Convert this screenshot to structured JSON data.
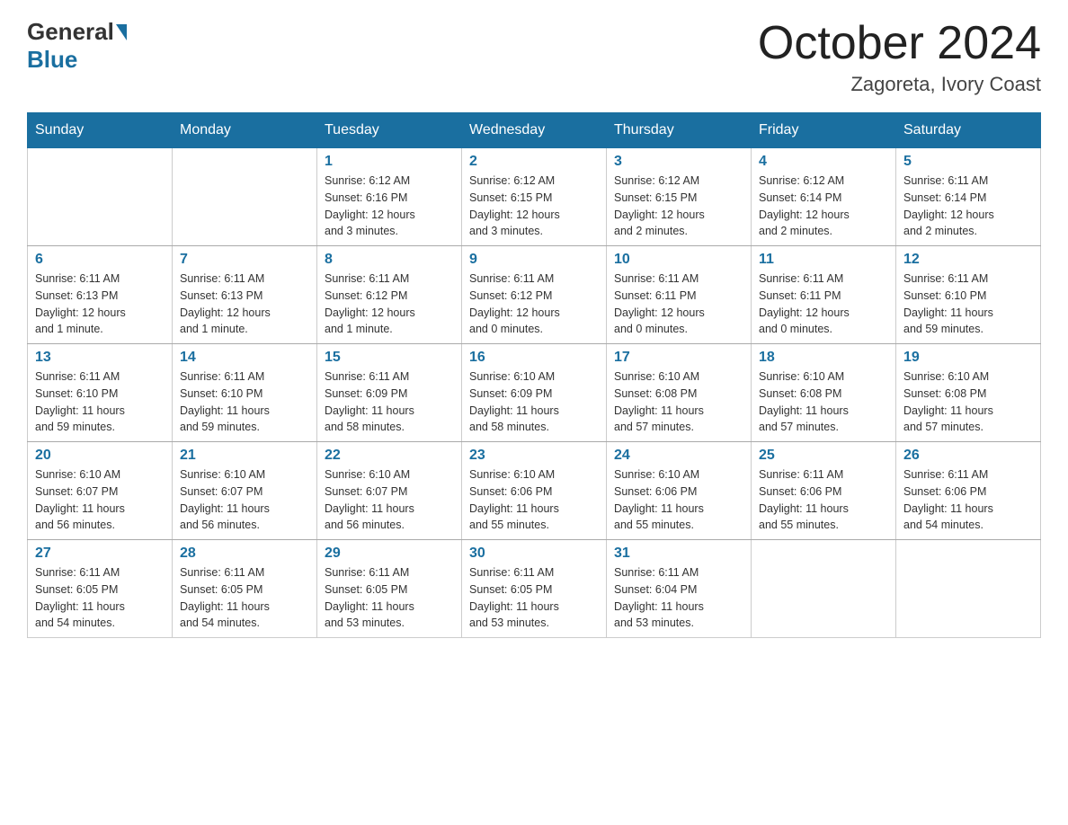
{
  "header": {
    "logo_general": "General",
    "logo_blue": "Blue",
    "month_title": "October 2024",
    "location": "Zagoreta, Ivory Coast"
  },
  "weekdays": [
    "Sunday",
    "Monday",
    "Tuesday",
    "Wednesday",
    "Thursday",
    "Friday",
    "Saturday"
  ],
  "weeks": [
    [
      {
        "day": "",
        "info": ""
      },
      {
        "day": "",
        "info": ""
      },
      {
        "day": "1",
        "info": "Sunrise: 6:12 AM\nSunset: 6:16 PM\nDaylight: 12 hours\nand 3 minutes."
      },
      {
        "day": "2",
        "info": "Sunrise: 6:12 AM\nSunset: 6:15 PM\nDaylight: 12 hours\nand 3 minutes."
      },
      {
        "day": "3",
        "info": "Sunrise: 6:12 AM\nSunset: 6:15 PM\nDaylight: 12 hours\nand 2 minutes."
      },
      {
        "day": "4",
        "info": "Sunrise: 6:12 AM\nSunset: 6:14 PM\nDaylight: 12 hours\nand 2 minutes."
      },
      {
        "day": "5",
        "info": "Sunrise: 6:11 AM\nSunset: 6:14 PM\nDaylight: 12 hours\nand 2 minutes."
      }
    ],
    [
      {
        "day": "6",
        "info": "Sunrise: 6:11 AM\nSunset: 6:13 PM\nDaylight: 12 hours\nand 1 minute."
      },
      {
        "day": "7",
        "info": "Sunrise: 6:11 AM\nSunset: 6:13 PM\nDaylight: 12 hours\nand 1 minute."
      },
      {
        "day": "8",
        "info": "Sunrise: 6:11 AM\nSunset: 6:12 PM\nDaylight: 12 hours\nand 1 minute."
      },
      {
        "day": "9",
        "info": "Sunrise: 6:11 AM\nSunset: 6:12 PM\nDaylight: 12 hours\nand 0 minutes."
      },
      {
        "day": "10",
        "info": "Sunrise: 6:11 AM\nSunset: 6:11 PM\nDaylight: 12 hours\nand 0 minutes."
      },
      {
        "day": "11",
        "info": "Sunrise: 6:11 AM\nSunset: 6:11 PM\nDaylight: 12 hours\nand 0 minutes."
      },
      {
        "day": "12",
        "info": "Sunrise: 6:11 AM\nSunset: 6:10 PM\nDaylight: 11 hours\nand 59 minutes."
      }
    ],
    [
      {
        "day": "13",
        "info": "Sunrise: 6:11 AM\nSunset: 6:10 PM\nDaylight: 11 hours\nand 59 minutes."
      },
      {
        "day": "14",
        "info": "Sunrise: 6:11 AM\nSunset: 6:10 PM\nDaylight: 11 hours\nand 59 minutes."
      },
      {
        "day": "15",
        "info": "Sunrise: 6:11 AM\nSunset: 6:09 PM\nDaylight: 11 hours\nand 58 minutes."
      },
      {
        "day": "16",
        "info": "Sunrise: 6:10 AM\nSunset: 6:09 PM\nDaylight: 11 hours\nand 58 minutes."
      },
      {
        "day": "17",
        "info": "Sunrise: 6:10 AM\nSunset: 6:08 PM\nDaylight: 11 hours\nand 57 minutes."
      },
      {
        "day": "18",
        "info": "Sunrise: 6:10 AM\nSunset: 6:08 PM\nDaylight: 11 hours\nand 57 minutes."
      },
      {
        "day": "19",
        "info": "Sunrise: 6:10 AM\nSunset: 6:08 PM\nDaylight: 11 hours\nand 57 minutes."
      }
    ],
    [
      {
        "day": "20",
        "info": "Sunrise: 6:10 AM\nSunset: 6:07 PM\nDaylight: 11 hours\nand 56 minutes."
      },
      {
        "day": "21",
        "info": "Sunrise: 6:10 AM\nSunset: 6:07 PM\nDaylight: 11 hours\nand 56 minutes."
      },
      {
        "day": "22",
        "info": "Sunrise: 6:10 AM\nSunset: 6:07 PM\nDaylight: 11 hours\nand 56 minutes."
      },
      {
        "day": "23",
        "info": "Sunrise: 6:10 AM\nSunset: 6:06 PM\nDaylight: 11 hours\nand 55 minutes."
      },
      {
        "day": "24",
        "info": "Sunrise: 6:10 AM\nSunset: 6:06 PM\nDaylight: 11 hours\nand 55 minutes."
      },
      {
        "day": "25",
        "info": "Sunrise: 6:11 AM\nSunset: 6:06 PM\nDaylight: 11 hours\nand 55 minutes."
      },
      {
        "day": "26",
        "info": "Sunrise: 6:11 AM\nSunset: 6:06 PM\nDaylight: 11 hours\nand 54 minutes."
      }
    ],
    [
      {
        "day": "27",
        "info": "Sunrise: 6:11 AM\nSunset: 6:05 PM\nDaylight: 11 hours\nand 54 minutes."
      },
      {
        "day": "28",
        "info": "Sunrise: 6:11 AM\nSunset: 6:05 PM\nDaylight: 11 hours\nand 54 minutes."
      },
      {
        "day": "29",
        "info": "Sunrise: 6:11 AM\nSunset: 6:05 PM\nDaylight: 11 hours\nand 53 minutes."
      },
      {
        "day": "30",
        "info": "Sunrise: 6:11 AM\nSunset: 6:05 PM\nDaylight: 11 hours\nand 53 minutes."
      },
      {
        "day": "31",
        "info": "Sunrise: 6:11 AM\nSunset: 6:04 PM\nDaylight: 11 hours\nand 53 minutes."
      },
      {
        "day": "",
        "info": ""
      },
      {
        "day": "",
        "info": ""
      }
    ]
  ]
}
